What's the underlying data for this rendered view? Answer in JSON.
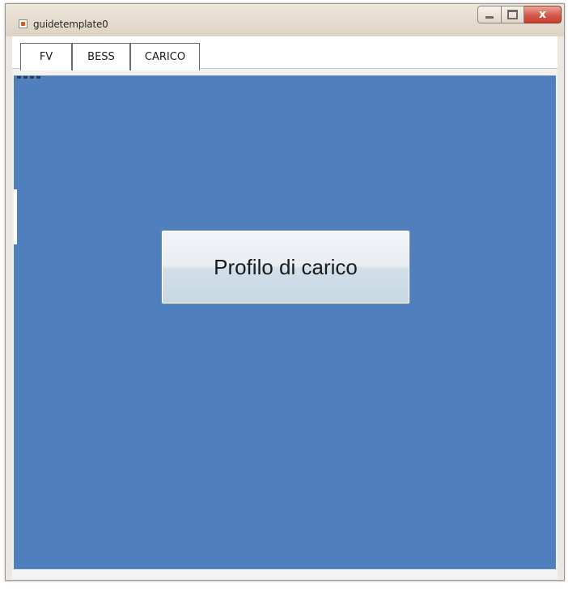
{
  "window": {
    "title": "guidetemplate0",
    "controls": {
      "minimize_icon": "minimize-icon",
      "maximize_icon": "maximize-icon",
      "close_icon": "close-icon",
      "close_glyph": "x"
    }
  },
  "tabs": [
    {
      "label": "FV"
    },
    {
      "label": "BESS"
    },
    {
      "label": "CARICO"
    }
  ],
  "panel": {
    "background_color": "#4f80bd",
    "button_label": "Profilo di carico"
  }
}
